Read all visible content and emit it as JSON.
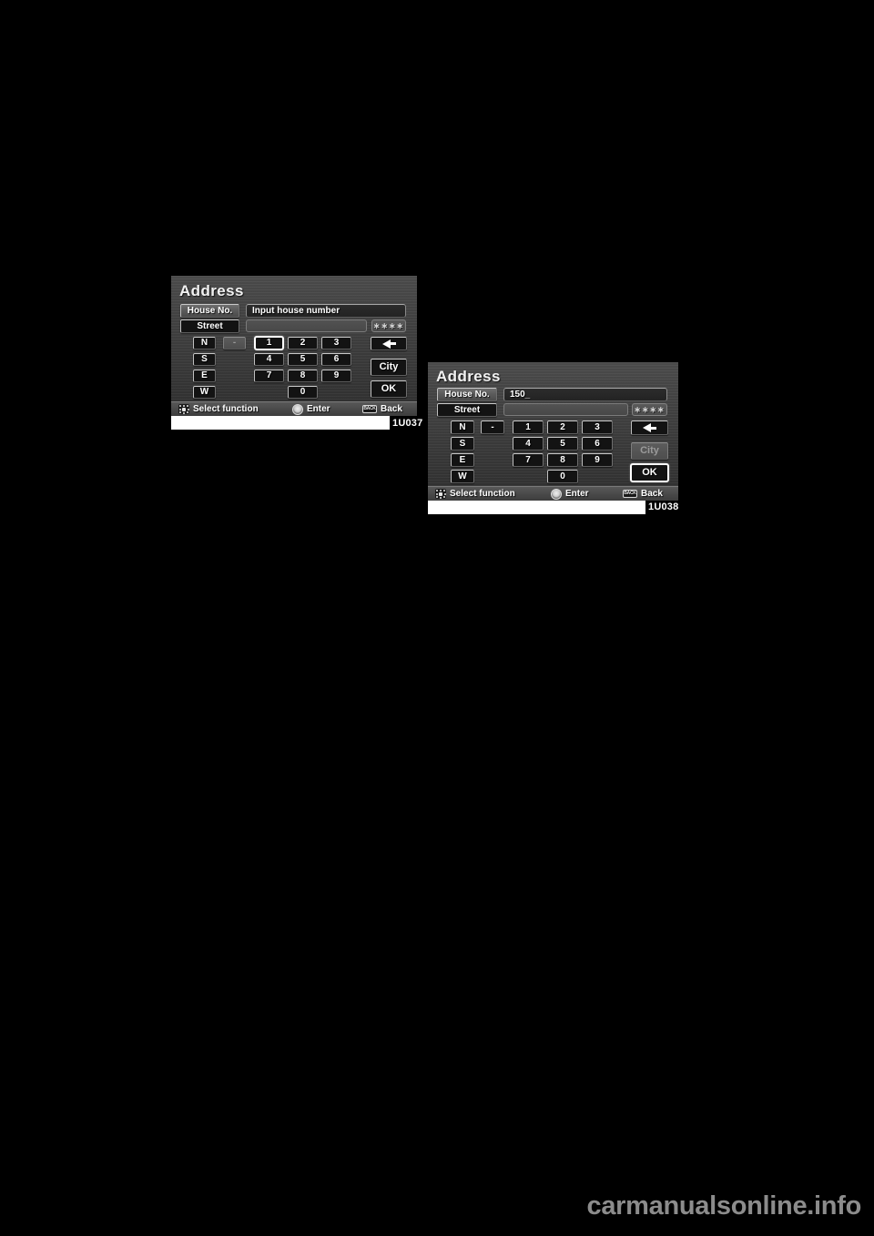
{
  "page": {
    "background_color": "#000000",
    "watermark": "carmanualsonline.info"
  },
  "screenshots": [
    {
      "caption": "1U037",
      "title": "Address",
      "tabs": [
        {
          "label": "House No.",
          "state": "active-light"
        },
        {
          "label": "Street",
          "state": "dark"
        }
      ],
      "fields": [
        {
          "name": "house-number-field",
          "value": "Input house number",
          "filled": true
        },
        {
          "name": "street-field",
          "value": "",
          "filled": false
        }
      ],
      "stars": "∗∗∗∗",
      "direction_keys": [
        "N",
        "S",
        "E",
        "W"
      ],
      "dash_key": "-",
      "keypad": [
        "1",
        "2",
        "3",
        "4",
        "5",
        "6",
        "7",
        "8",
        "9",
        "0"
      ],
      "focused_key": "1",
      "side_buttons": [
        {
          "label": "",
          "name": "backspace-button",
          "icon": "left-arrow-icon",
          "state": "normal"
        },
        {
          "label": "City",
          "name": "city-button",
          "state": "normal"
        },
        {
          "label": "OK",
          "name": "ok-button",
          "state": "normal"
        }
      ],
      "help": [
        {
          "icon": "joystick-icon",
          "label": "Select function"
        },
        {
          "icon": "enter-icon",
          "label": "Enter"
        },
        {
          "icon": "back-icon",
          "label": "Back",
          "icon_text": "BACK"
        }
      ]
    },
    {
      "caption": "1U038",
      "title": "Address",
      "tabs": [
        {
          "label": "House No.",
          "state": "active-light"
        },
        {
          "label": "Street",
          "state": "dark"
        }
      ],
      "fields": [
        {
          "name": "house-number-field",
          "value": "150_",
          "filled": true
        },
        {
          "name": "street-field",
          "value": "",
          "filled": false
        }
      ],
      "stars": "∗∗∗∗",
      "direction_keys": [
        "N",
        "S",
        "E",
        "W"
      ],
      "dash_key": "-",
      "keypad": [
        "1",
        "2",
        "3",
        "4",
        "5",
        "6",
        "7",
        "8",
        "9",
        "0"
      ],
      "focused_key": "",
      "side_buttons": [
        {
          "label": "",
          "name": "backspace-button",
          "icon": "left-arrow-icon",
          "state": "normal"
        },
        {
          "label": "City",
          "name": "city-button",
          "state": "dim"
        },
        {
          "label": "OK",
          "name": "ok-button",
          "state": "focused"
        }
      ],
      "help": [
        {
          "icon": "joystick-icon",
          "label": "Select function"
        },
        {
          "icon": "enter-icon",
          "label": "Enter"
        },
        {
          "icon": "back-icon",
          "label": "Back",
          "icon_text": "BACK"
        }
      ]
    }
  ]
}
